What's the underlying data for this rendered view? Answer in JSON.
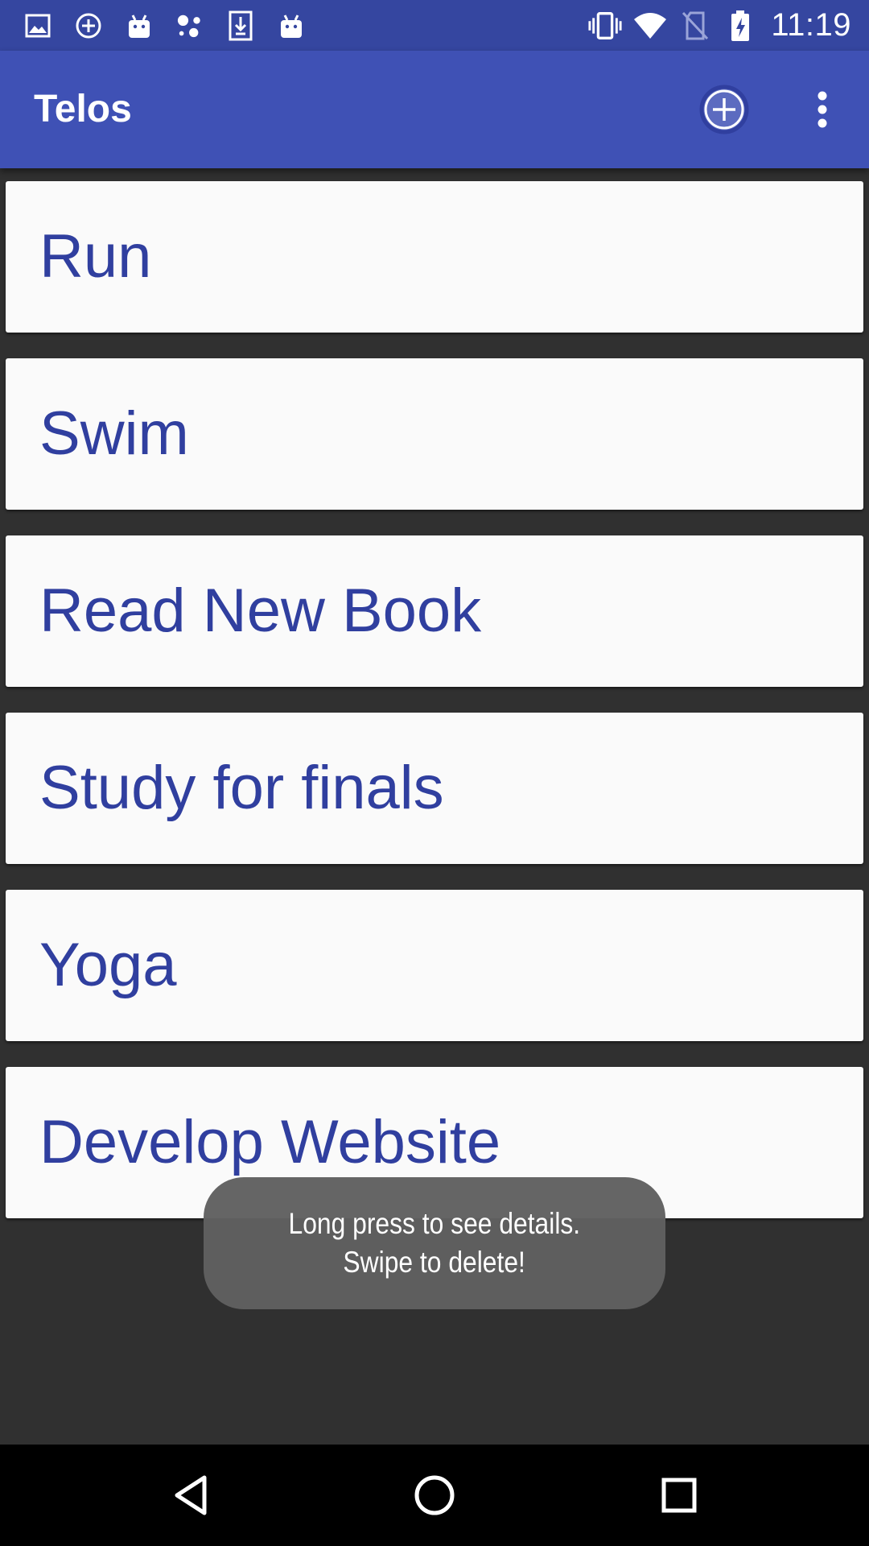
{
  "status_bar": {
    "left_icons": [
      "image-icon",
      "add-circle-icon",
      "android-icon",
      "assistant-dots-icon",
      "download-icon",
      "android-icon"
    ],
    "right_icons": [
      "vibrate-icon",
      "wifi-icon",
      "no-sim-icon",
      "battery-charging-icon"
    ],
    "time": "11:19"
  },
  "app_bar": {
    "title": "Telos",
    "add_icon": "add-circle-icon",
    "overflow_icon": "more-vert-icon"
  },
  "goals": [
    {
      "label": "Run"
    },
    {
      "label": "Swim"
    },
    {
      "label": "Read New Book"
    },
    {
      "label": "Study for finals"
    },
    {
      "label": "Yoga"
    },
    {
      "label": "Develop Website"
    }
  ],
  "toast": {
    "line1": "Long press to see details.",
    "line2": "Swipe to delete!"
  },
  "nav_bar": {
    "back_icon": "back-triangle-icon",
    "home_icon": "home-circle-icon",
    "recents_icon": "recents-square-icon"
  },
  "colors": {
    "status_bar": "#3546a0",
    "app_bar": "#3f51b5",
    "card_text": "#303f9f",
    "card_bg": "#fafafa",
    "background": "#303030",
    "toast_bg": "#5f5f5f"
  }
}
